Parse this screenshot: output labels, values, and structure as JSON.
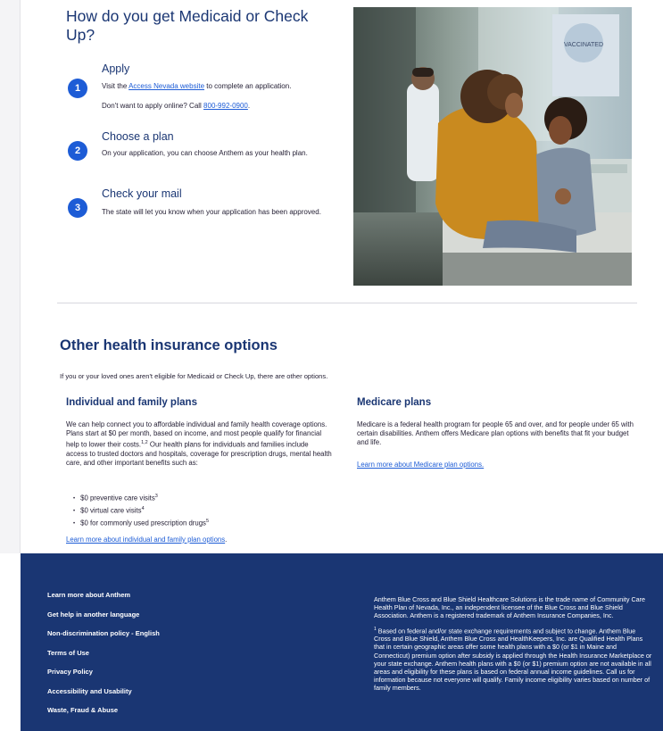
{
  "hero": {
    "title": "How do you get Medicaid or Check Up?"
  },
  "steps": [
    {
      "number": "1",
      "title": "Apply",
      "line1_prefix": "Visit the ",
      "line1_link": "Access Nevada website",
      "line1_suffix": " to complete an application.",
      "line2_prefix": "Don't want to apply online? Call ",
      "line2_link": "800-992-0900",
      "line2_suffix": "."
    },
    {
      "number": "2",
      "title": "Choose a plan",
      "text": "On your application, you can choose Anthem as your health plan."
    },
    {
      "number": "3",
      "title": "Check your mail",
      "text": "The state will let you know when your application has been approved."
    }
  ],
  "photo": {
    "alt": "vaccination-poster-clinic-scene",
    "poster_text": "VACCINATED"
  },
  "other_options": {
    "title": "Other health insurance options",
    "intro": "If you or your loved ones aren't eligible for Medicaid or Check Up, there are other options.",
    "individual": {
      "title": "Individual and family plans",
      "text_before_sup": "We can help connect you to affordable individual and family health coverage options. Plans start at $0 per month, based on income, and most people qualify for financial help to lower their costs.",
      "sup": "1,2",
      "text_after_sup": " Our health plans for individuals and families include access to trusted doctors and hospitals, coverage for prescription drugs, mental health care, and other important benefits such as:",
      "bullets": [
        {
          "text": "$0 preventive care visits",
          "sup": "3"
        },
        {
          "text": "$0 virtual care visits",
          "sup": "4"
        },
        {
          "text": "$0 for commonly used prescription drugs",
          "sup": "5"
        }
      ],
      "link": "Learn more about individual and family plan options",
      "link_suffix": "."
    },
    "medicare": {
      "title": "Medicare plans",
      "text": "Medicare is a federal health program for people 65 and over, and for people under 65 with certain disabilities. Anthem offers Medicare plan options with benefits that fit your budget and life.",
      "link": "Learn more about Medicare plan options."
    }
  },
  "footer": {
    "links": [
      "Learn more about Anthem",
      "Get help in another language",
      "Non-discrimination policy - English",
      "Terms of Use",
      "Privacy Policy",
      "Accessibility and Usability",
      "Waste, Fraud & Abuse"
    ],
    "legal_1": "Anthem Blue Cross and Blue Shield Healthcare Solutions is the trade name of Community Care Health Plan of Nevada, Inc., an independent licensee of the Blue Cross and Blue Shield Association. Anthem is a registered trademark of Anthem Insurance Companies, Inc.",
    "legal_2_sup": "1",
    "legal_2": " Based on federal and/or state exchange requirements and subject to change. Anthem Blue Cross and Blue Shield, Anthem Blue Cross and HealthKeepers, Inc. are Qualified Health Plans that in certain geographic areas offer some health plans with a $0 (or $1 in Maine and Connecticut) premium option after subsidy is applied through the Health Insurance Marketplace or your state exchange. Anthem health plans with a $0 (or $1) premium option are not available in all areas and eligibility for these plans is based on federal annual income guidelines. Call us for information because not everyone will qualify. Family income eligibility varies based on number of family members."
  },
  "colors": {
    "heading": "#1a3673",
    "accent": "#1d5cd6",
    "footer_bg": "#1a3673"
  }
}
